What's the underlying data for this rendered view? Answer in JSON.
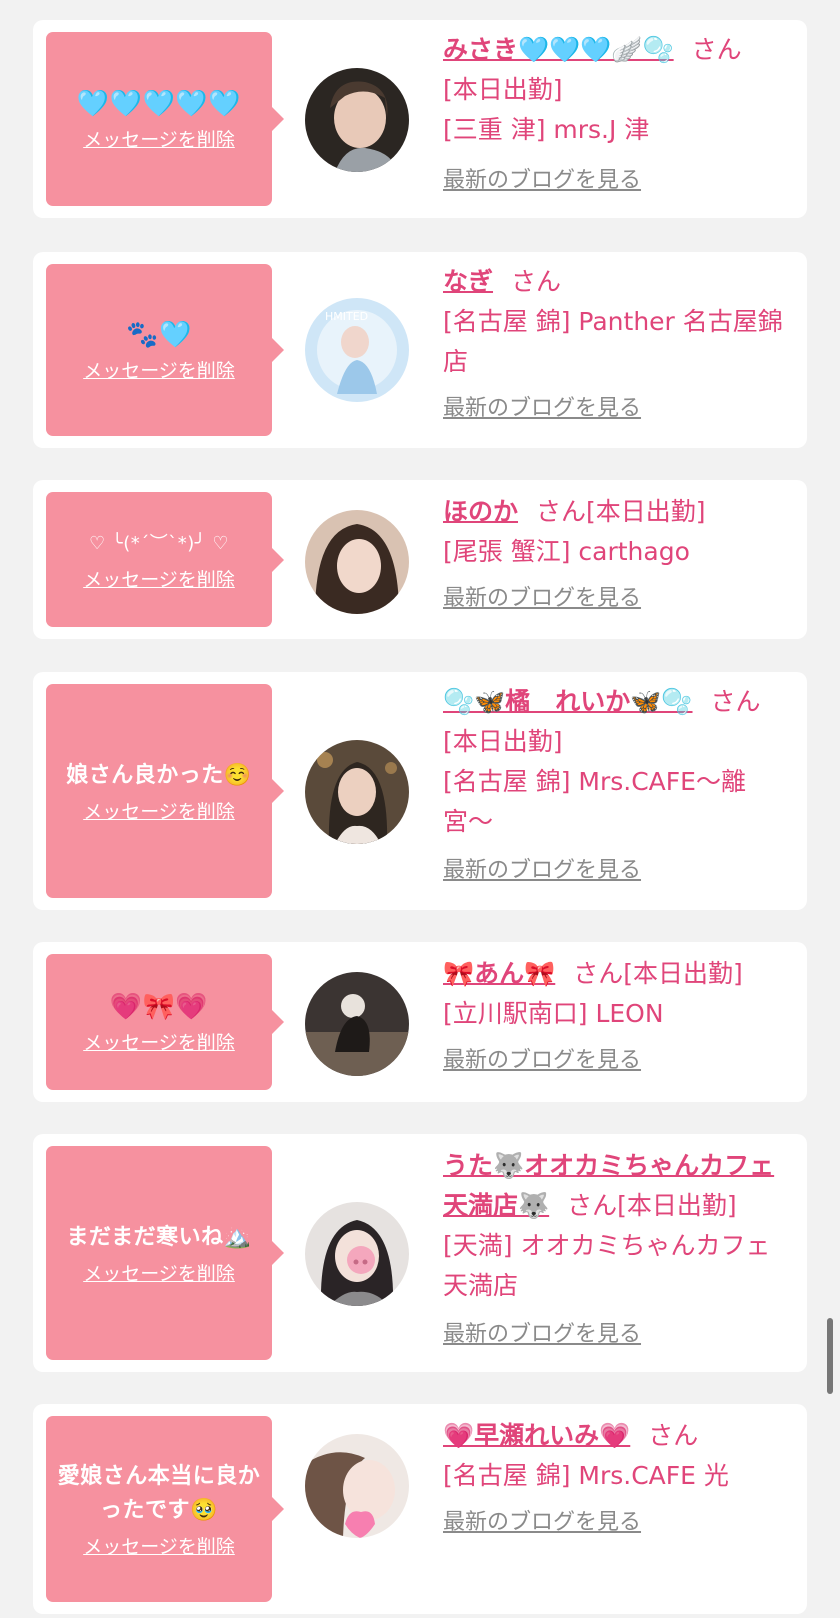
{
  "common": {
    "delete_label": "メッセージを削除",
    "blog_label": "最新のブログを見る",
    "san": "さん"
  },
  "cards": [
    {
      "message": "🩵🩵🩵🩵🩵",
      "name": "みさき🩵🩵🩵🪽🫧",
      "status": "[本日出勤]",
      "shop": "[三重 津] mrs.J 津"
    },
    {
      "message": "🐾🩵",
      "name": "なぎ",
      "status": "",
      "shop": "[名古屋 錦] Panther 名古屋錦店"
    },
    {
      "message": "♡ ╰(*´︶`*)╯ ♡",
      "name": "ほのか",
      "status": "[本日出勤]",
      "shop": "[尾張 蟹江] carthago"
    },
    {
      "message": "娘さん良かった☺️",
      "name": "🫧🦋橘　れいか🦋🫧",
      "status": "[本日出勤]",
      "shop": "[名古屋 錦] Mrs.CAFE〜離宮〜"
    },
    {
      "message": "💗🎀💗",
      "name": "🎀あん🎀",
      "status": "[本日出勤]",
      "shop": "[立川駅南口] LEON"
    },
    {
      "message": "まだまだ寒いね🏔️",
      "name": "うた🐺オオカミちゃんカフェ天満店🐺",
      "status": "[本日出勤]",
      "shop": "[天満] オオカミちゃんカフェ天満店"
    },
    {
      "message": "愛娘さん本当に良かったです🥹",
      "name": "💗早瀬れいみ💗",
      "status": "",
      "shop": "[名古屋 錦] Mrs.CAFE 光"
    }
  ],
  "colors": {
    "bubble": "#f6919f",
    "accent": "#e0457a",
    "link_gray": "#8a8a8a",
    "background": "#f2f2f2"
  }
}
